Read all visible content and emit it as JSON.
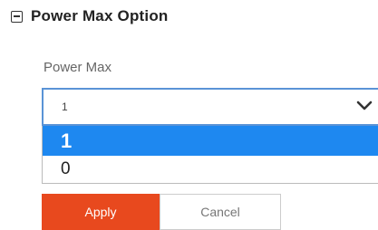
{
  "section": {
    "title": "Power Max Option",
    "collapse_icon": "collapse-minus-icon"
  },
  "field": {
    "label": "Power Max",
    "selected_value": "1",
    "chevron_icon": "chevron-down-icon",
    "options": [
      "1",
      "0"
    ]
  },
  "buttons": {
    "apply_label": "Apply",
    "cancel_label": "Cancel"
  },
  "colors": {
    "accent": "#1e88f0",
    "focus_border": "#5a93d6",
    "apply_bg": "#e8491e"
  }
}
